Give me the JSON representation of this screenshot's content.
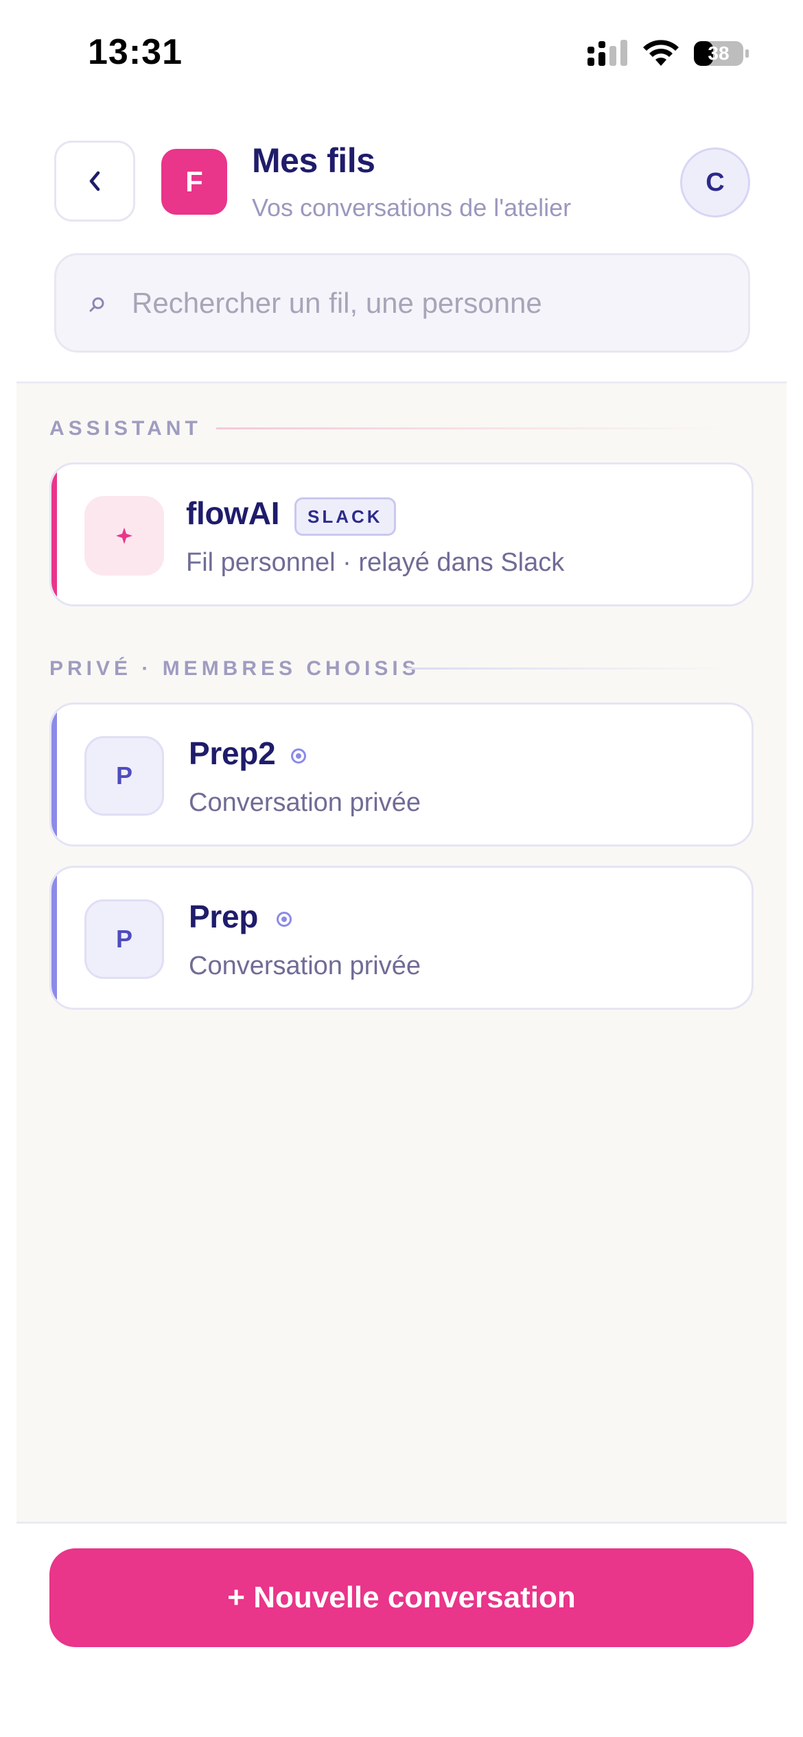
{
  "status_bar": {
    "time": "13:31",
    "battery_level": "38"
  },
  "header": {
    "back_icon": "chevron-left-icon",
    "app_initial": "F",
    "title": "Mes fils",
    "subtitle": "Vos conversations de l'atelier",
    "avatar_initial": "C"
  },
  "search": {
    "placeholder": "Rechercher un fil, une personne",
    "value": "",
    "icon": "search-icon"
  },
  "sections": [
    {
      "label": "ASSISTANT",
      "items": [
        {
          "title": "flowAI",
          "badge": "SLACK",
          "subtitle": "Fil personnel · relayé dans Slack",
          "thumb_icon": "sparkle-icon"
        }
      ]
    },
    {
      "label": "PRIVÉ · MEMBRES CHOISIS",
      "items": [
        {
          "title": "Prep2",
          "initial": "P",
          "subtitle": "Conversation privée",
          "status_icon": "private-indicator-icon"
        },
        {
          "title": "Prep",
          "initial": "P",
          "subtitle": "Conversation privée",
          "status_icon": "private-indicator-icon"
        }
      ]
    }
  ],
  "footer": {
    "new_conversation_label": "+ Nouvelle conversation"
  },
  "colors": {
    "brand_pink": "#e9358a",
    "navy_text": "#1f1c6b",
    "private_accent": "#8c8ae8",
    "muted_text": "#9b98be",
    "content_bg": "#f9f8f5"
  }
}
